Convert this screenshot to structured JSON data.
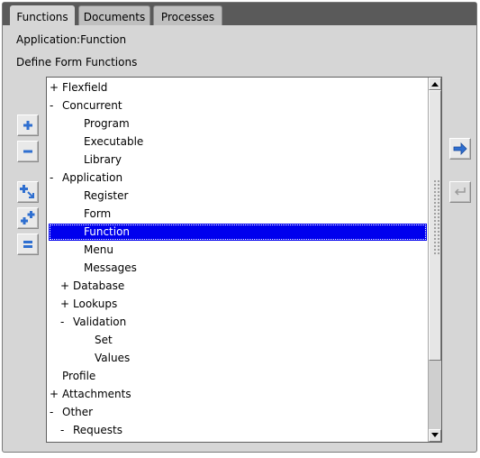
{
  "tabs": [
    {
      "label": "Functions",
      "active": true
    },
    {
      "label": "Documents",
      "active": false
    },
    {
      "label": "Processes",
      "active": false
    }
  ],
  "header": {
    "path": "Application:Function",
    "section": "Define Form Functions"
  },
  "tree": {
    "items": [
      {
        "toggle": "+",
        "label": "Flexfield",
        "level": 0
      },
      {
        "toggle": "-",
        "label": "Concurrent",
        "level": 0
      },
      {
        "toggle": "",
        "label": "Program",
        "level": 1
      },
      {
        "toggle": "",
        "label": "Executable",
        "level": 1
      },
      {
        "toggle": "",
        "label": "Library",
        "level": 1
      },
      {
        "toggle": "-",
        "label": "Application",
        "level": 0
      },
      {
        "toggle": "",
        "label": "Register",
        "level": 1
      },
      {
        "toggle": "",
        "label": "Form",
        "level": 1
      },
      {
        "toggle": "",
        "label": "Function",
        "level": 1,
        "selected": true
      },
      {
        "toggle": "",
        "label": "Menu",
        "level": 1
      },
      {
        "toggle": "",
        "label": "Messages",
        "level": 1
      },
      {
        "toggle": "+",
        "label": "Database",
        "level": 1
      },
      {
        "toggle": "+",
        "label": "Lookups",
        "level": 1
      },
      {
        "toggle": "-",
        "label": "Validation",
        "level": 1
      },
      {
        "toggle": "",
        "label": "Set",
        "level": 2
      },
      {
        "toggle": "",
        "label": "Values",
        "level": 2
      },
      {
        "toggle": "",
        "label": "Profile",
        "level": 0
      },
      {
        "toggle": "+",
        "label": "Attachments",
        "level": 0
      },
      {
        "toggle": "-",
        "label": "Other",
        "level": 0
      },
      {
        "toggle": "-",
        "label": "Requests",
        "level": 1
      }
    ]
  },
  "colors": {
    "selection": "#0000ee",
    "accent_blue": "#2f6fd0",
    "tab_strip": "#5a5a5a"
  }
}
